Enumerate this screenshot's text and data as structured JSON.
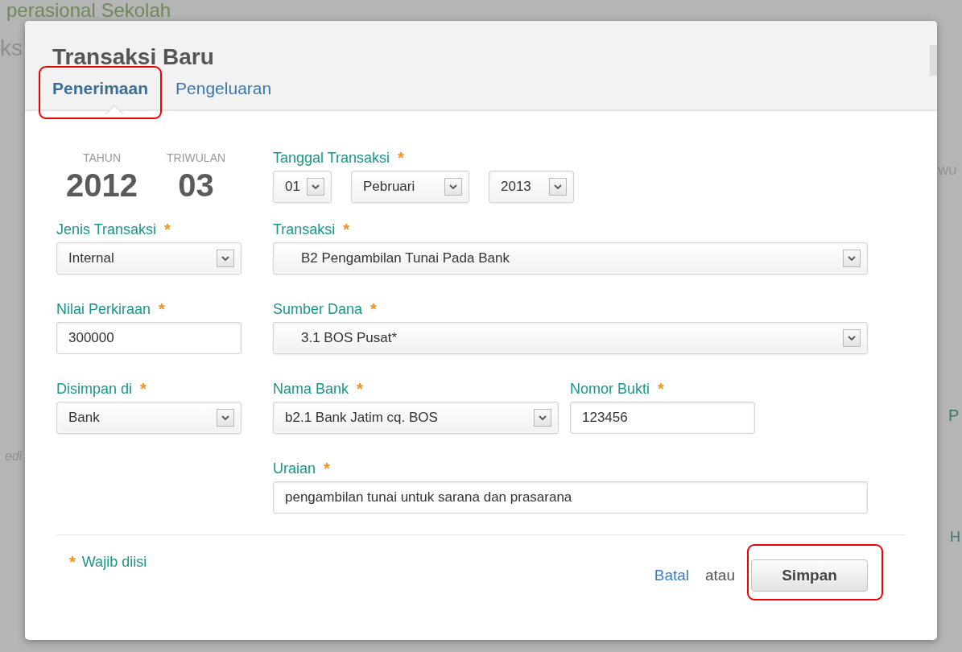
{
  "background": {
    "title": "perasional Sekolah",
    "texts": [
      {
        "kind": "left",
        "text": "ks"
      },
      {
        "kind": "left_italic",
        "text": "edi"
      },
      {
        "kind": "right_small",
        "text": "WU"
      },
      {
        "kind": "right_link",
        "text": "P"
      },
      {
        "kind": "right_low",
        "text": "H"
      }
    ]
  },
  "dialog": {
    "title": "Transaksi Baru",
    "tabs": [
      {
        "label": "Penerimaan",
        "selected": true,
        "highlighted": true
      },
      {
        "label": "Pengeluaran",
        "selected": false,
        "highlighted": false
      }
    ],
    "period": {
      "year_label": "TAHUN",
      "year": "2012",
      "quarter_label": "TRIWULAN",
      "quarter": "03"
    },
    "tanggal_transaksi": {
      "label": "Tanggal Transaksi",
      "mark": "*",
      "day": "01",
      "month": "Pebruari",
      "year": "2013"
    },
    "jenis_transaksi": {
      "label": "Jenis Transaksi",
      "mark": "*",
      "kind": "select",
      "value": "Internal"
    },
    "transaksi": {
      "label": "Transaksi",
      "mark": "*",
      "kind": "select",
      "value": "B2 Pengambilan Tunai Pada Bank"
    },
    "nilai_perkiraan": {
      "label": "Nilai Perkiraan",
      "mark": "*",
      "kind": "text",
      "value": "300000"
    },
    "sumber_dana": {
      "label": "Sumber Dana",
      "mark": "*",
      "kind": "select",
      "value": "3.1 BOS Pusat*"
    },
    "disimpan_di": {
      "label": "Disimpan di",
      "mark": "*",
      "kind": "select",
      "value": "Bank"
    },
    "nama_bank": {
      "label": "Nama Bank",
      "mark": "*",
      "kind": "select",
      "value": "b2.1 Bank Jatim cq. BOS"
    },
    "nomor_bukti": {
      "label": "Nomor Bukti",
      "mark": "*",
      "kind": "text",
      "value": "123456"
    },
    "uraian": {
      "label": "Uraian",
      "mark": "*",
      "kind": "text",
      "value": "pengambilan tunai untuk sarana dan prasarana"
    },
    "legend": {
      "mark": "*",
      "text": "Wajib diisi"
    },
    "cancel_link": "Batal",
    "separator": "atau",
    "save_button": {
      "label": "Simpan",
      "highlighted": true
    }
  }
}
